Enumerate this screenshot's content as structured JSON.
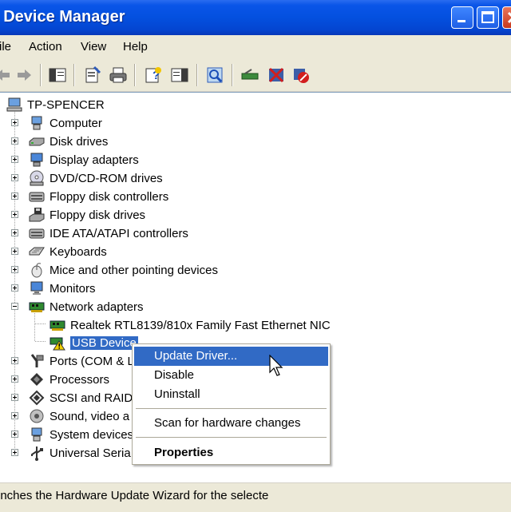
{
  "window": {
    "title": "Device Manager"
  },
  "menubar": [
    "ile",
    "Action",
    "View",
    "Help"
  ],
  "toolbar": [
    {
      "icon": "back-arrow-icon"
    },
    {
      "icon": "forward-arrow-icon"
    },
    {
      "icon": "show-hide-console-tree-icon"
    },
    {
      "icon": "properties-icon"
    },
    {
      "icon": "print-icon"
    },
    {
      "icon": "help-icon"
    },
    {
      "icon": "show-hide-action-pane-icon"
    },
    {
      "icon": "scan-hardware-icon"
    },
    {
      "icon": "update-driver-icon"
    },
    {
      "icon": "uninstall-icon"
    },
    {
      "icon": "disable-icon"
    }
  ],
  "tree": {
    "root": "TP-SPENCER",
    "items": [
      {
        "label": "Computer",
        "icon": "computer-icon"
      },
      {
        "label": "Disk drives",
        "icon": "disk-drive-icon"
      },
      {
        "label": "Display adapters",
        "icon": "display-adapter-icon"
      },
      {
        "label": "DVD/CD-ROM drives",
        "icon": "cdrom-icon"
      },
      {
        "label": "Floppy disk controllers",
        "icon": "controller-icon"
      },
      {
        "label": "Floppy disk drives",
        "icon": "floppy-icon"
      },
      {
        "label": "IDE ATA/ATAPI controllers",
        "icon": "controller-icon"
      },
      {
        "label": "Keyboards",
        "icon": "keyboard-icon"
      },
      {
        "label": "Mice and other pointing devices",
        "icon": "mouse-icon"
      },
      {
        "label": "Monitors",
        "icon": "monitor-icon"
      },
      {
        "label": "Network adapters",
        "icon": "network-card-icon"
      },
      {
        "label": "Realtek RTL8139/810x Family Fast Ethernet NIC",
        "icon": "network-card-icon"
      },
      {
        "label": "USB Device",
        "icon": "warning-device-icon"
      },
      {
        "label": "Ports (COM & L",
        "icon": "port-icon"
      },
      {
        "label": "Processors",
        "icon": "processor-icon"
      },
      {
        "label": "SCSI and RAID",
        "icon": "scsi-icon"
      },
      {
        "label": "Sound, video a",
        "icon": "sound-icon"
      },
      {
        "label": "System devices",
        "icon": "system-icon"
      },
      {
        "label": "Universal Seria",
        "icon": "usb-icon"
      }
    ]
  },
  "context_menu": {
    "items": [
      "Update Driver...",
      "Disable",
      "Uninstall",
      "Scan for hardware changes",
      "Properties"
    ]
  },
  "status": "unches the Hardware Update Wizard for the selecte",
  "colors": {
    "selection": "#316AC5",
    "titlebar": "#0450DF"
  }
}
